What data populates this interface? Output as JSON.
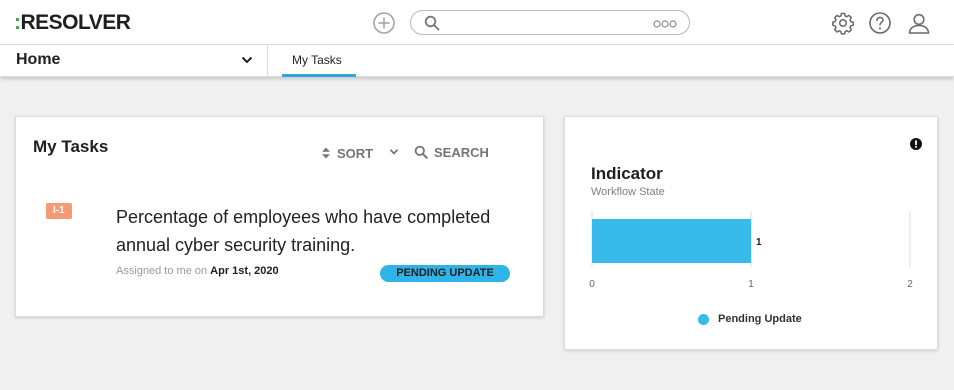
{
  "app": {
    "logo_text": "RESOLVER",
    "logo_dots": ":"
  },
  "header": {
    "search_value": "",
    "icons": [
      "add-icon",
      "search-icon",
      "more-icon",
      "settings-icon",
      "help-icon",
      "user-icon"
    ]
  },
  "nav": {
    "selected": "Home",
    "tabs": [
      {
        "label": "My Tasks",
        "active": true
      }
    ]
  },
  "tasks_card": {
    "title": "My Tasks",
    "sort_label": "SORT",
    "search_label": "SEARCH",
    "items": [
      {
        "id": "I-1",
        "title": "Percentage of employees who have completed annual cyber security training.",
        "assigned_prefix": "Assigned to me on ",
        "assigned_date": "Apr 1st, 2020",
        "status": "PENDING UPDATE"
      }
    ]
  },
  "indicator_card": {
    "title": "Indicator",
    "subtitle": "Workflow State"
  },
  "chart_data": {
    "type": "bar",
    "orientation": "horizontal",
    "categories": [
      "Pending Update"
    ],
    "series": [
      {
        "name": "Pending Update",
        "values": [
          1
        ],
        "color": "#38bbea"
      }
    ],
    "data_labels": [
      "1"
    ],
    "xlim": [
      0,
      2
    ],
    "x_ticks": [
      "0",
      "1",
      "2"
    ],
    "grid": true,
    "legend_position": "bottom"
  },
  "colors": {
    "accent": "#29a8dc",
    "badge": "#2fb3e8",
    "id_tag": "#f59a73",
    "logo_dots": "#3aa655"
  }
}
